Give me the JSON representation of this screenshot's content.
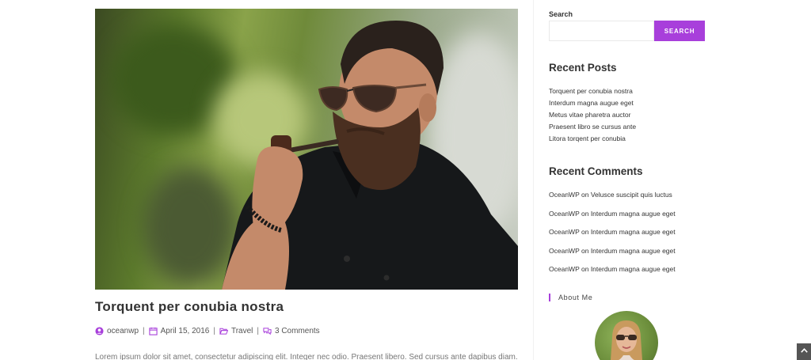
{
  "post": {
    "title": "Torquent per conubia nostra",
    "author": "oceanwp",
    "date": "April 15, 2016",
    "category": "Travel",
    "comments": "3 Comments",
    "separator": "|",
    "excerpt": "Lorem ipsum dolor sit amet, consectetur adipiscing elit. Integer nec odio. Praesent libero. Sed cursus ante dapibus diam. Sed nisi."
  },
  "sidebar": {
    "search": {
      "label": "Search",
      "placeholder": "",
      "value": "",
      "button_label": "SEARCH"
    },
    "recent_posts": {
      "title": "Recent Posts",
      "items": [
        "Torquent per conubia nostra",
        "Interdum magna augue eget",
        "Metus vitae pharetra auctor",
        "Praesent libro se cursus ante",
        "Litora torqent per conubia"
      ]
    },
    "recent_comments": {
      "title": "Recent Comments",
      "items": [
        {
          "author": "OceanWP",
          "on": "on",
          "post": "Velusce suscipit quis luctus"
        },
        {
          "author": "OceanWP",
          "on": "on",
          "post": "Interdum magna augue eget"
        },
        {
          "author": "OceanWP",
          "on": "on",
          "post": "Interdum magna augue eget"
        },
        {
          "author": "OceanWP",
          "on": "on",
          "post": "Interdum magna augue eget"
        },
        {
          "author": "OceanWP",
          "on": "on",
          "post": "Interdum magna augue eget"
        }
      ]
    },
    "about": {
      "title": "About Me"
    }
  },
  "colors": {
    "accent": "#a83fdb",
    "text": "#333333",
    "muted": "#777777"
  },
  "icons": {
    "author": "user-circle-icon",
    "date": "calendar-icon",
    "category": "folder-open-icon",
    "comments": "comments-icon",
    "scroll": "chevron-up-icon"
  }
}
